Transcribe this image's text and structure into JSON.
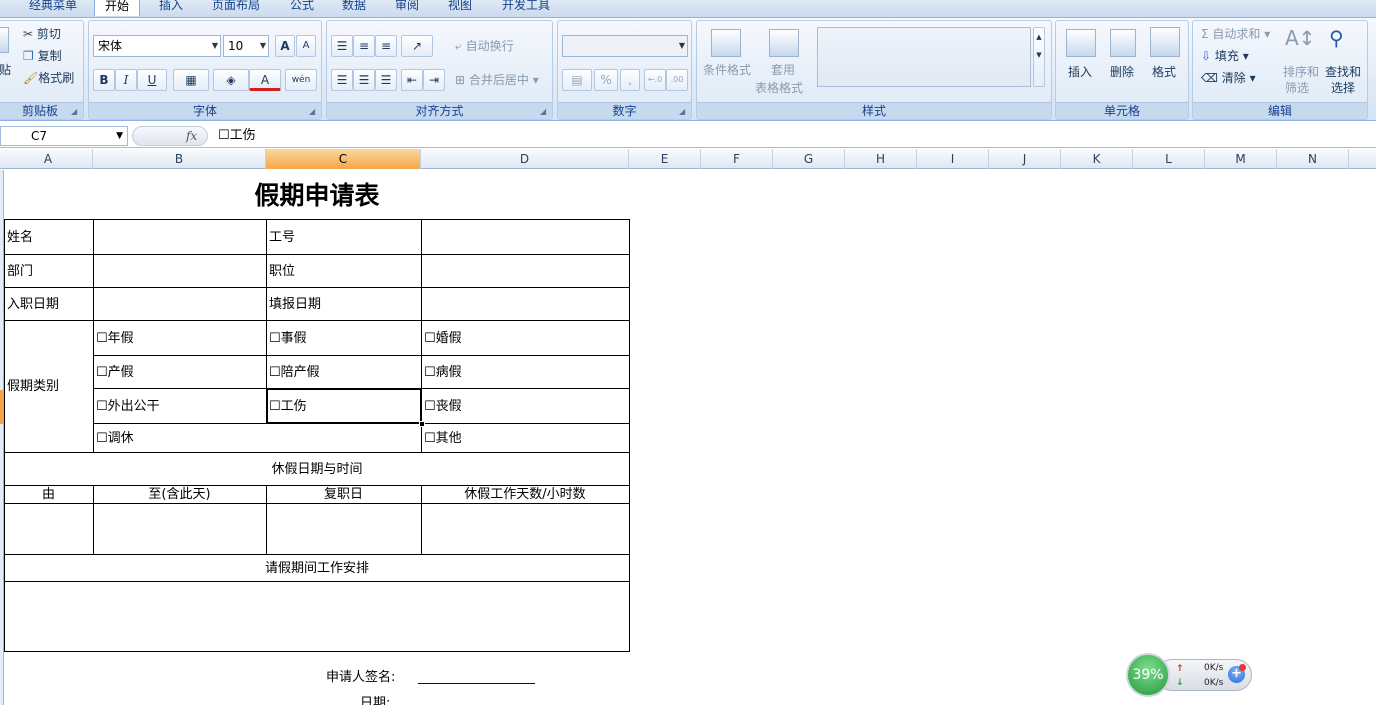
{
  "tabs": [
    "经典菜单",
    "开始",
    "插入",
    "页面布局",
    "公式",
    "数据",
    "审阅",
    "视图",
    "开发工具"
  ],
  "active_tab": "开始",
  "ribbon": {
    "clipboard": {
      "paste_fragment": "贴",
      "cut": "剪切",
      "copy": "复制",
      "format_painter": "格式刷",
      "label": "剪贴板"
    },
    "font": {
      "font_name": "宋体",
      "font_size": "10",
      "grow": "A",
      "shrink": "A",
      "bold": "B",
      "italic": "I",
      "underline": "U",
      "font_color": "A",
      "phonetic": "wén",
      "label": "字体"
    },
    "alignment": {
      "wrap_text": "自动换行",
      "merge_center": "合并后居中",
      "label": "对齐方式"
    },
    "number": {
      "format_value": "",
      "percent": "%",
      "comma": ",",
      "inc_decimal": "←.0",
      "dec_decimal": ".00",
      "label": "数字"
    },
    "styles": {
      "conditional": "条件格式",
      "table_format_1": "套用",
      "table_format_2": "表格格式",
      "label": "样式"
    },
    "cells": {
      "insert": "插入",
      "delete": "删除",
      "format": "格式",
      "label": "单元格"
    },
    "editing": {
      "autosum": "自动求和",
      "fill": "填充",
      "clear": "清除",
      "sort_1": "排序和",
      "sort_2": "筛选",
      "find_1": "查找和",
      "find_2": "选择",
      "label": "编辑"
    }
  },
  "formula_bar": {
    "cell_ref": "C7",
    "fx": "fx",
    "content": "☐工伤"
  },
  "columns": [
    "A",
    "B",
    "C",
    "D",
    "E",
    "F",
    "G",
    "H",
    "I",
    "J",
    "K",
    "L",
    "M",
    "N"
  ],
  "selected_column": "C",
  "sheet": {
    "title": "假期申请表",
    "name_label": "姓名",
    "id_label": "工号",
    "dept_label": "部门",
    "position_label": "职位",
    "join_date_label": "入职日期",
    "fill_date_label": "填报日期",
    "leave_type_label": "假期类别",
    "leave_options": {
      "annual": "☐年假",
      "personal": "☐事假",
      "marriage": "☐婚假",
      "maternity": "☐产假",
      "paternity": "☐陪产假",
      "sick": "☐病假",
      "business": "☐外出公干",
      "injury": "☐工伤",
      "funeral": "☐丧假",
      "compensatory": "☐调休",
      "other": "☐其他"
    },
    "leave_period_header": "休假日期与时间",
    "from_label": "由",
    "to_label": "至(含此天)",
    "return_label": "复职日",
    "days_label": "休假工作天数/小时数",
    "arrangement_header": "请假期间工作安排",
    "signature_label": "申请人签名:",
    "signature_line": "__________________",
    "date_label": "日期:"
  },
  "net_widget": {
    "percent": "39%",
    "up_speed": "0K/s",
    "down_speed": "0K/s"
  },
  "colors": {
    "accent": "#15428b",
    "selected_header": "#f5a64a",
    "gauge": "#229a3c"
  }
}
